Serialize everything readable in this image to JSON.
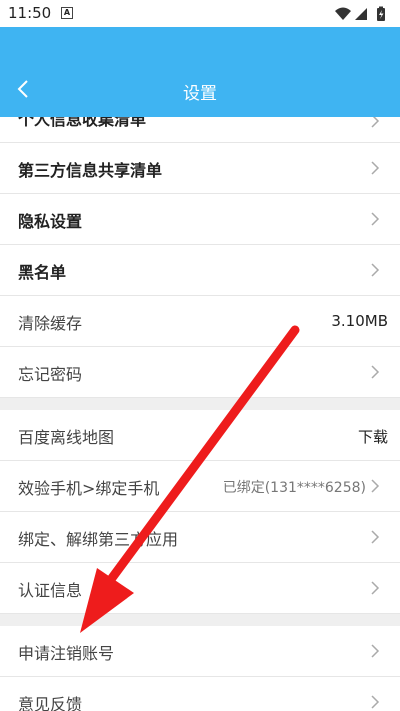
{
  "status": {
    "time": "11:50",
    "notif_icon": "A"
  },
  "header": {
    "title": "设置"
  },
  "rows_top": [
    {
      "label": "个人信息收集清单"
    },
    {
      "label": "第三方信息共享清单"
    },
    {
      "label": "隐私设置"
    },
    {
      "label": "黑名单"
    },
    {
      "label": "清除缓存",
      "value": "3.10MB"
    },
    {
      "label": "忘记密码"
    }
  ],
  "rows_mid": [
    {
      "label": "百度离线地图",
      "value": "下载"
    },
    {
      "label": "效验手机>绑定手机",
      "value": "已绑定(131****6258)"
    },
    {
      "label": "绑定、解绑第三方应用"
    },
    {
      "label": "认证信息"
    }
  ],
  "rows_bottom": [
    {
      "label": "申请注销账号"
    },
    {
      "label": "意见反馈"
    }
  ],
  "colors": {
    "header": "#3fb4f2",
    "arrow": "#ee1c1c"
  }
}
